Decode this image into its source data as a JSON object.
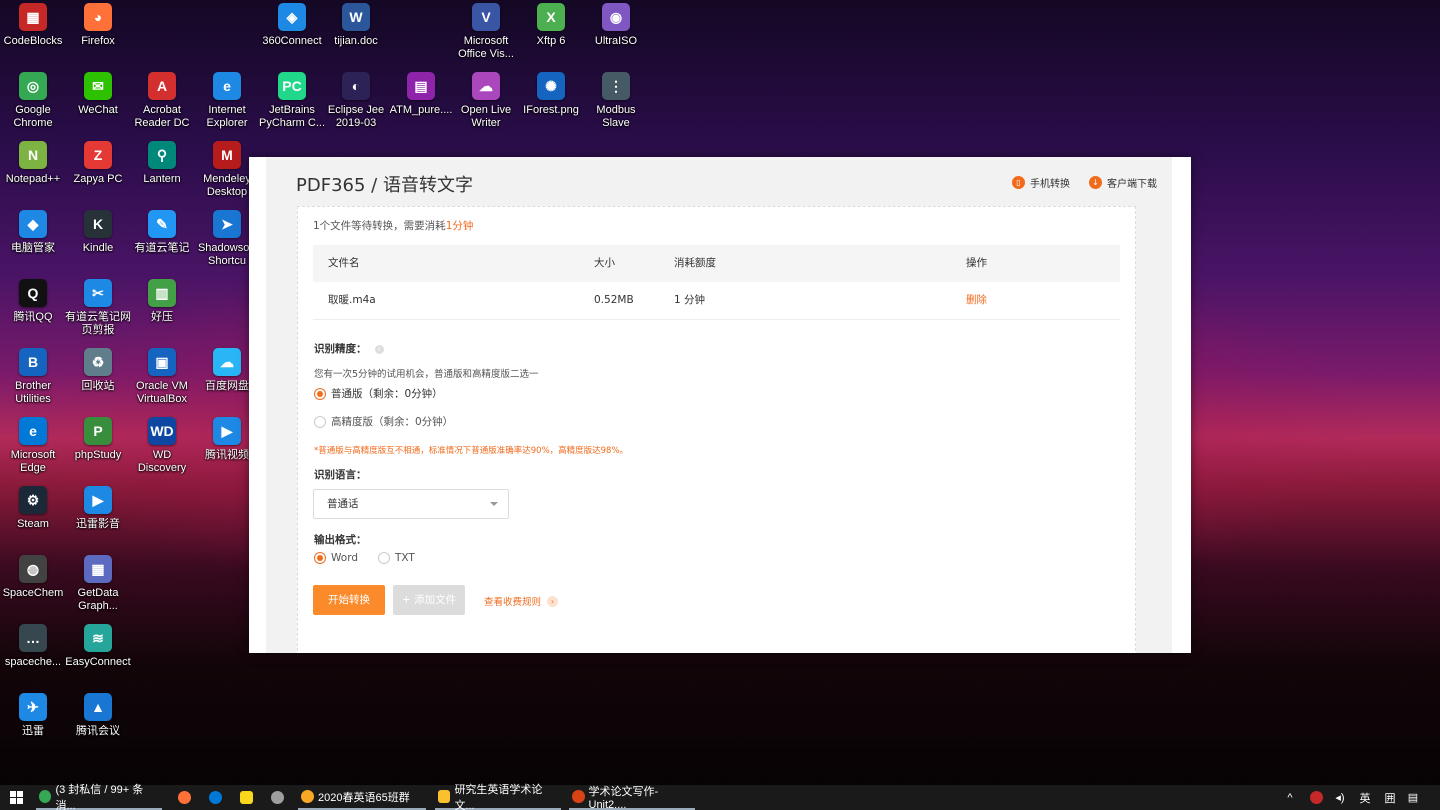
{
  "desktop": {
    "icons": [
      {
        "label": "CodeBlocks",
        "icon": "codeblocks-icon",
        "color": "#c62828",
        "glyph": "▦"
      },
      {
        "label": "Firefox",
        "icon": "firefox-icon",
        "color": "#ff7139",
        "glyph": "◕"
      },
      {
        "label": "360Connect",
        "icon": "360connect-icon",
        "color": "#1e88e5",
        "glyph": "◈"
      },
      {
        "label": "tijian.doc",
        "icon": "word-doc-icon",
        "color": "#2b579a",
        "glyph": "W"
      },
      {
        "label": "Microsoft Office Vis...",
        "icon": "visio-icon",
        "color": "#3955a3",
        "glyph": "V"
      },
      {
        "label": "Xftp 6",
        "icon": "xftp-icon",
        "color": "#4caf50",
        "glyph": "X"
      },
      {
        "label": "UltraISO",
        "icon": "ultraiso-icon",
        "color": "#7e57c2",
        "glyph": "◉"
      },
      {
        "label": "Google Chrome",
        "icon": "chrome-icon",
        "color": "#34a853",
        "glyph": "◎"
      },
      {
        "label": "WeChat",
        "icon": "wechat-icon",
        "color": "#2dc100",
        "glyph": "✉"
      },
      {
        "label": "Acrobat Reader DC",
        "icon": "acrobat-icon",
        "color": "#d32f2f",
        "glyph": "A"
      },
      {
        "label": "Internet Explorer",
        "icon": "ie-icon",
        "color": "#1e88e5",
        "glyph": "e"
      },
      {
        "label": "JetBrains PyCharm C...",
        "icon": "pycharm-icon",
        "color": "#21d789",
        "glyph": "PC"
      },
      {
        "label": "Eclipse Jee 2019-03",
        "icon": "eclipse-icon",
        "color": "#2c2255",
        "glyph": "◐"
      },
      {
        "label": "ATM_pure....",
        "icon": "archive-icon",
        "color": "#8e24aa",
        "glyph": "▤"
      },
      {
        "label": "Open Live Writer",
        "icon": "livewriter-icon",
        "color": "#ab47bc",
        "glyph": "☁"
      },
      {
        "label": "IForest.png",
        "icon": "image-file-icon",
        "color": "#1565c0",
        "glyph": "✺"
      },
      {
        "label": "Modbus Slave",
        "icon": "modbus-icon",
        "color": "#455a64",
        "glyph": "⋮"
      },
      {
        "label": "Notepad++",
        "icon": "notepadpp-icon",
        "color": "#7cb342",
        "glyph": "N"
      },
      {
        "label": "Zapya PC",
        "icon": "zapya-icon",
        "color": "#e53935",
        "glyph": "Z"
      },
      {
        "label": "Lantern",
        "icon": "lantern-icon",
        "color": "#00897b",
        "glyph": "⚲"
      },
      {
        "label": "Mendeley Desktop",
        "icon": "mendeley-icon",
        "color": "#b71c1c",
        "glyph": "M"
      },
      {
        "label": "电脑管家",
        "icon": "pc-manager-icon",
        "color": "#1e88e5",
        "glyph": "◆"
      },
      {
        "label": "Kindle",
        "icon": "kindle-icon",
        "color": "#263238",
        "glyph": "K"
      },
      {
        "label": "有道云笔记",
        "icon": "youdao-note-icon",
        "color": "#2196f3",
        "glyph": "✎"
      },
      {
        "label": "Shadowso - Shortcu",
        "icon": "shadowsocks-icon",
        "color": "#1976d2",
        "glyph": "➤"
      },
      {
        "label": "腾讯QQ",
        "icon": "qq-icon",
        "color": "#111111",
        "glyph": "Q"
      },
      {
        "label": "有道云笔记网页剪报",
        "icon": "youdao-clipper-icon",
        "color": "#1e88e5",
        "glyph": "✂"
      },
      {
        "label": "好压",
        "icon": "haozip-icon",
        "color": "#43a047",
        "glyph": "▥"
      },
      {
        "label": "Brother Utilities",
        "icon": "brother-icon",
        "color": "#1565c0",
        "glyph": "B"
      },
      {
        "label": "回收站",
        "icon": "recycle-bin-icon",
        "color": "#607d8b",
        "glyph": "♻"
      },
      {
        "label": "Oracle VM VirtualBox",
        "icon": "virtualbox-icon",
        "color": "#1565c0",
        "glyph": "▣"
      },
      {
        "label": "百度网盘",
        "icon": "baidu-netdisk-icon",
        "color": "#29b6f6",
        "glyph": "☁"
      },
      {
        "label": "Microsoft Edge",
        "icon": "edge-icon",
        "color": "#0078d7",
        "glyph": "e"
      },
      {
        "label": "phpStudy",
        "icon": "phpstudy-icon",
        "color": "#388e3c",
        "glyph": "P"
      },
      {
        "label": "WD Discovery",
        "icon": "wd-discovery-icon",
        "color": "#0d47a1",
        "glyph": "WD"
      },
      {
        "label": "腾讯视频",
        "icon": "tencent-video-icon",
        "color": "#1e88e5",
        "glyph": "▶"
      },
      {
        "label": "Steam",
        "icon": "steam-icon",
        "color": "#1b2838",
        "glyph": "⚙"
      },
      {
        "label": "迅雷影音",
        "icon": "xunlei-player-icon",
        "color": "#1e88e5",
        "glyph": "▶"
      },
      {
        "label": "SpaceChem",
        "icon": "spacechem-icon",
        "color": "#424242",
        "glyph": "◍"
      },
      {
        "label": "GetData Graph...",
        "icon": "getdata-icon",
        "color": "#5c6bc0",
        "glyph": "▦"
      },
      {
        "label": "spaceche...",
        "icon": "spacechem-file-icon",
        "color": "#37474f",
        "glyph": "…"
      },
      {
        "label": "EasyConnect",
        "icon": "easyconnect-icon",
        "color": "#26a69a",
        "glyph": "≋"
      },
      {
        "label": "迅雷",
        "icon": "xunlei-icon",
        "color": "#1e88e5",
        "glyph": "✈"
      },
      {
        "label": "腾讯会议",
        "icon": "tencent-meeting-icon",
        "color": "#1976d2",
        "glyph": "▲"
      }
    ]
  },
  "app": {
    "brand": "PDF365",
    "separator": "/",
    "page_title": "语音转文字",
    "mobile_convert": "手机转换",
    "client_download": "客户端下载",
    "accent": "#f26b1d",
    "wait_prefix": "1个文件等待转换，需要消耗",
    "wait_highlight": "1分钟",
    "table": {
      "headers": [
        "文件名",
        "大小",
        "消耗额度",
        "操作"
      ],
      "rows": [
        {
          "name": "取暖.m4a",
          "size": "0.52MB",
          "cost": "1 分钟",
          "action": "删除"
        }
      ]
    },
    "precision_label": "识别精度：",
    "precision_info": "i",
    "trial_note": "您有一次5分钟的试用机会，普通版和高精度版二选一",
    "precision_options": [
      {
        "label": "普通版（剩余：0分钟）",
        "selected": true
      },
      {
        "label": "高精度版（剩余：0分钟）",
        "selected": false
      }
    ],
    "precision_warning": "*普通版与高精度版互不相通，标准情况下普通版准确率达90%，高精度版达98%。",
    "language_label": "识别语言：",
    "language_value": "普通话",
    "format_label": "输出格式：",
    "format_options": [
      {
        "label": "Word",
        "selected": true
      },
      {
        "label": "TXT",
        "selected": false
      }
    ],
    "start_button": "开始转换",
    "add_button": "添加文件",
    "add_plus": "+",
    "rules_link": "查看收费规则",
    "rules_arrow": "›"
  },
  "taskbar": {
    "tasks": [
      {
        "label": "(3 封私信 / 99+ 条消...",
        "icon": "chrome-icon",
        "color": "#34a853"
      },
      {
        "label": "2020春英语65班群",
        "icon": "qq-group-icon",
        "color": "#f9a825"
      },
      {
        "label": "研究生英语学术论文...",
        "icon": "folder-icon",
        "color": "#fbc02d"
      },
      {
        "label": "学术论文写作-Unit2....",
        "icon": "ppt-icon",
        "color": "#d84315"
      }
    ],
    "tray": {
      "chevron": "^",
      "ime": "英",
      "grid": "囲"
    }
  }
}
